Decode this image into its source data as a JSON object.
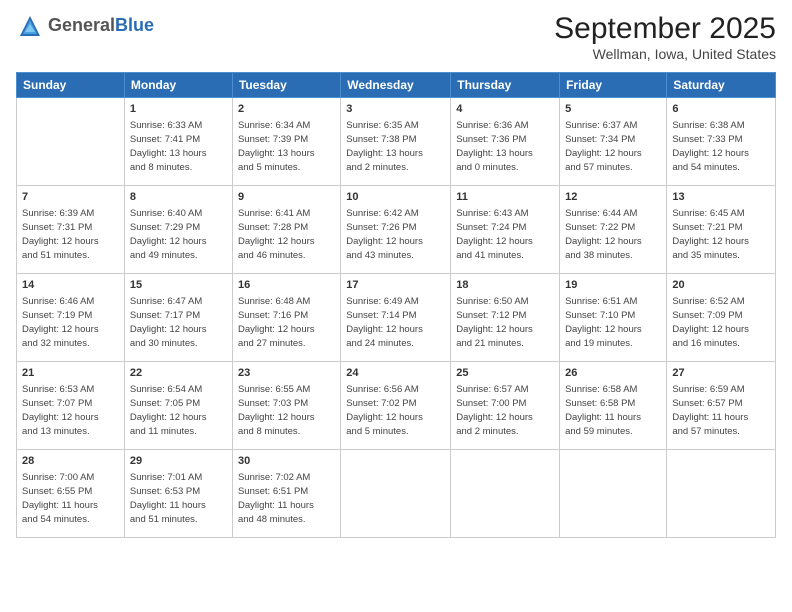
{
  "header": {
    "logo_general": "General",
    "logo_blue": "Blue",
    "month": "September 2025",
    "location": "Wellman, Iowa, United States"
  },
  "weekdays": [
    "Sunday",
    "Monday",
    "Tuesday",
    "Wednesday",
    "Thursday",
    "Friday",
    "Saturday"
  ],
  "weeks": [
    [
      {
        "day": "",
        "info": ""
      },
      {
        "day": "1",
        "info": "Sunrise: 6:33 AM\nSunset: 7:41 PM\nDaylight: 13 hours\nand 8 minutes."
      },
      {
        "day": "2",
        "info": "Sunrise: 6:34 AM\nSunset: 7:39 PM\nDaylight: 13 hours\nand 5 minutes."
      },
      {
        "day": "3",
        "info": "Sunrise: 6:35 AM\nSunset: 7:38 PM\nDaylight: 13 hours\nand 2 minutes."
      },
      {
        "day": "4",
        "info": "Sunrise: 6:36 AM\nSunset: 7:36 PM\nDaylight: 13 hours\nand 0 minutes."
      },
      {
        "day": "5",
        "info": "Sunrise: 6:37 AM\nSunset: 7:34 PM\nDaylight: 12 hours\nand 57 minutes."
      },
      {
        "day": "6",
        "info": "Sunrise: 6:38 AM\nSunset: 7:33 PM\nDaylight: 12 hours\nand 54 minutes."
      }
    ],
    [
      {
        "day": "7",
        "info": "Sunrise: 6:39 AM\nSunset: 7:31 PM\nDaylight: 12 hours\nand 51 minutes."
      },
      {
        "day": "8",
        "info": "Sunrise: 6:40 AM\nSunset: 7:29 PM\nDaylight: 12 hours\nand 49 minutes."
      },
      {
        "day": "9",
        "info": "Sunrise: 6:41 AM\nSunset: 7:28 PM\nDaylight: 12 hours\nand 46 minutes."
      },
      {
        "day": "10",
        "info": "Sunrise: 6:42 AM\nSunset: 7:26 PM\nDaylight: 12 hours\nand 43 minutes."
      },
      {
        "day": "11",
        "info": "Sunrise: 6:43 AM\nSunset: 7:24 PM\nDaylight: 12 hours\nand 41 minutes."
      },
      {
        "day": "12",
        "info": "Sunrise: 6:44 AM\nSunset: 7:22 PM\nDaylight: 12 hours\nand 38 minutes."
      },
      {
        "day": "13",
        "info": "Sunrise: 6:45 AM\nSunset: 7:21 PM\nDaylight: 12 hours\nand 35 minutes."
      }
    ],
    [
      {
        "day": "14",
        "info": "Sunrise: 6:46 AM\nSunset: 7:19 PM\nDaylight: 12 hours\nand 32 minutes."
      },
      {
        "day": "15",
        "info": "Sunrise: 6:47 AM\nSunset: 7:17 PM\nDaylight: 12 hours\nand 30 minutes."
      },
      {
        "day": "16",
        "info": "Sunrise: 6:48 AM\nSunset: 7:16 PM\nDaylight: 12 hours\nand 27 minutes."
      },
      {
        "day": "17",
        "info": "Sunrise: 6:49 AM\nSunset: 7:14 PM\nDaylight: 12 hours\nand 24 minutes."
      },
      {
        "day": "18",
        "info": "Sunrise: 6:50 AM\nSunset: 7:12 PM\nDaylight: 12 hours\nand 21 minutes."
      },
      {
        "day": "19",
        "info": "Sunrise: 6:51 AM\nSunset: 7:10 PM\nDaylight: 12 hours\nand 19 minutes."
      },
      {
        "day": "20",
        "info": "Sunrise: 6:52 AM\nSunset: 7:09 PM\nDaylight: 12 hours\nand 16 minutes."
      }
    ],
    [
      {
        "day": "21",
        "info": "Sunrise: 6:53 AM\nSunset: 7:07 PM\nDaylight: 12 hours\nand 13 minutes."
      },
      {
        "day": "22",
        "info": "Sunrise: 6:54 AM\nSunset: 7:05 PM\nDaylight: 12 hours\nand 11 minutes."
      },
      {
        "day": "23",
        "info": "Sunrise: 6:55 AM\nSunset: 7:03 PM\nDaylight: 12 hours\nand 8 minutes."
      },
      {
        "day": "24",
        "info": "Sunrise: 6:56 AM\nSunset: 7:02 PM\nDaylight: 12 hours\nand 5 minutes."
      },
      {
        "day": "25",
        "info": "Sunrise: 6:57 AM\nSunset: 7:00 PM\nDaylight: 12 hours\nand 2 minutes."
      },
      {
        "day": "26",
        "info": "Sunrise: 6:58 AM\nSunset: 6:58 PM\nDaylight: 11 hours\nand 59 minutes."
      },
      {
        "day": "27",
        "info": "Sunrise: 6:59 AM\nSunset: 6:57 PM\nDaylight: 11 hours\nand 57 minutes."
      }
    ],
    [
      {
        "day": "28",
        "info": "Sunrise: 7:00 AM\nSunset: 6:55 PM\nDaylight: 11 hours\nand 54 minutes."
      },
      {
        "day": "29",
        "info": "Sunrise: 7:01 AM\nSunset: 6:53 PM\nDaylight: 11 hours\nand 51 minutes."
      },
      {
        "day": "30",
        "info": "Sunrise: 7:02 AM\nSunset: 6:51 PM\nDaylight: 11 hours\nand 48 minutes."
      },
      {
        "day": "",
        "info": ""
      },
      {
        "day": "",
        "info": ""
      },
      {
        "day": "",
        "info": ""
      },
      {
        "day": "",
        "info": ""
      }
    ]
  ]
}
